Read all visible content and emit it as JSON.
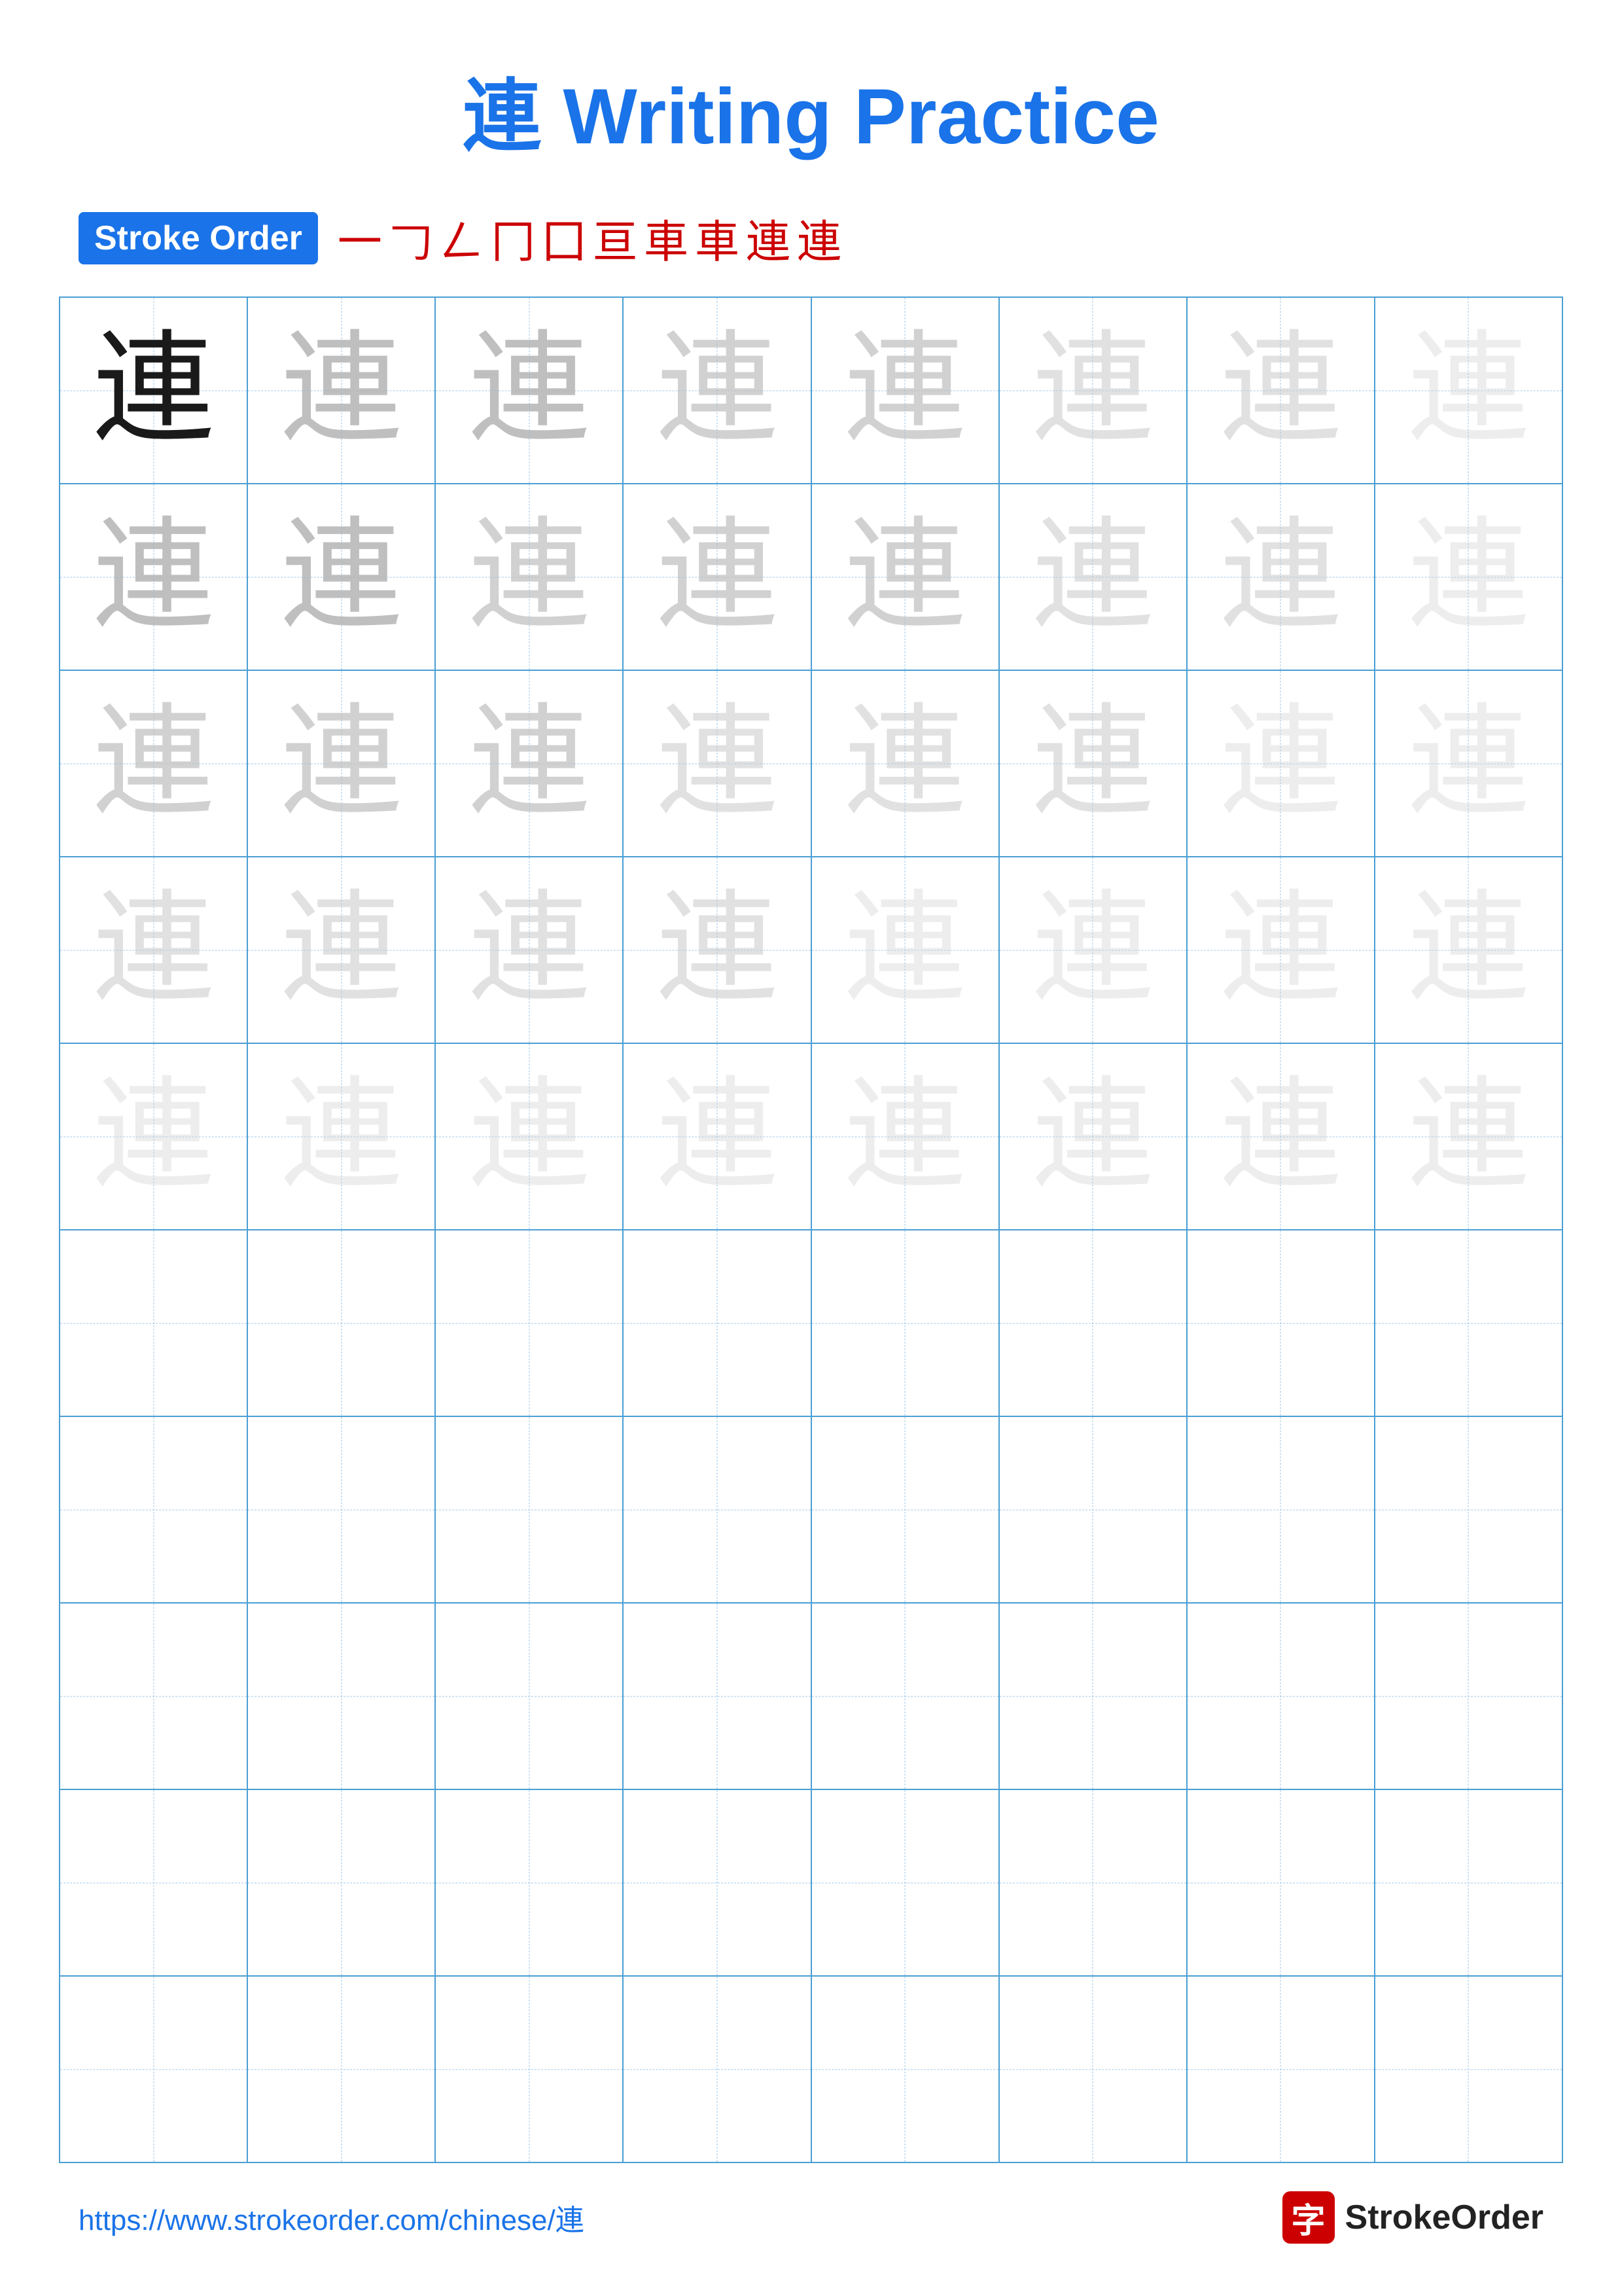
{
  "title": {
    "chinese": "連",
    "english": " Writing Practice"
  },
  "stroke_order": {
    "label": "Stroke Order",
    "chars": [
      "一",
      "𠃌",
      "𠃋",
      "冂",
      "囗",
      "亘",
      "車",
      "車",
      "連",
      "連"
    ]
  },
  "character": "連",
  "rows": [
    {
      "opacity_class": [
        "char-dark",
        "char-light-1",
        "char-light-1",
        "char-light-2",
        "char-light-2",
        "char-light-3",
        "char-light-3",
        "char-light-4"
      ]
    },
    {
      "opacity_class": [
        "char-light-1",
        "char-light-1",
        "char-light-2",
        "char-light-2",
        "char-light-2",
        "char-light-3",
        "char-light-3",
        "char-light-4"
      ]
    },
    {
      "opacity_class": [
        "char-light-2",
        "char-light-2",
        "char-light-2",
        "char-light-3",
        "char-light-3",
        "char-light-3",
        "char-light-4",
        "char-light-4"
      ]
    },
    {
      "opacity_class": [
        "char-light-3",
        "char-light-3",
        "char-light-3",
        "char-light-3",
        "char-light-4",
        "char-light-4",
        "char-light-4",
        "char-light-4"
      ]
    },
    {
      "opacity_class": [
        "char-light-4",
        "char-light-4",
        "char-light-4",
        "char-light-4",
        "char-light-4",
        "char-light-4",
        "char-light-4",
        "char-light-4"
      ]
    }
  ],
  "empty_rows": 5,
  "footer": {
    "url": "https://www.strokeorder.com/chinese/連",
    "brand_char": "字",
    "brand_name": "StrokeOrder"
  }
}
